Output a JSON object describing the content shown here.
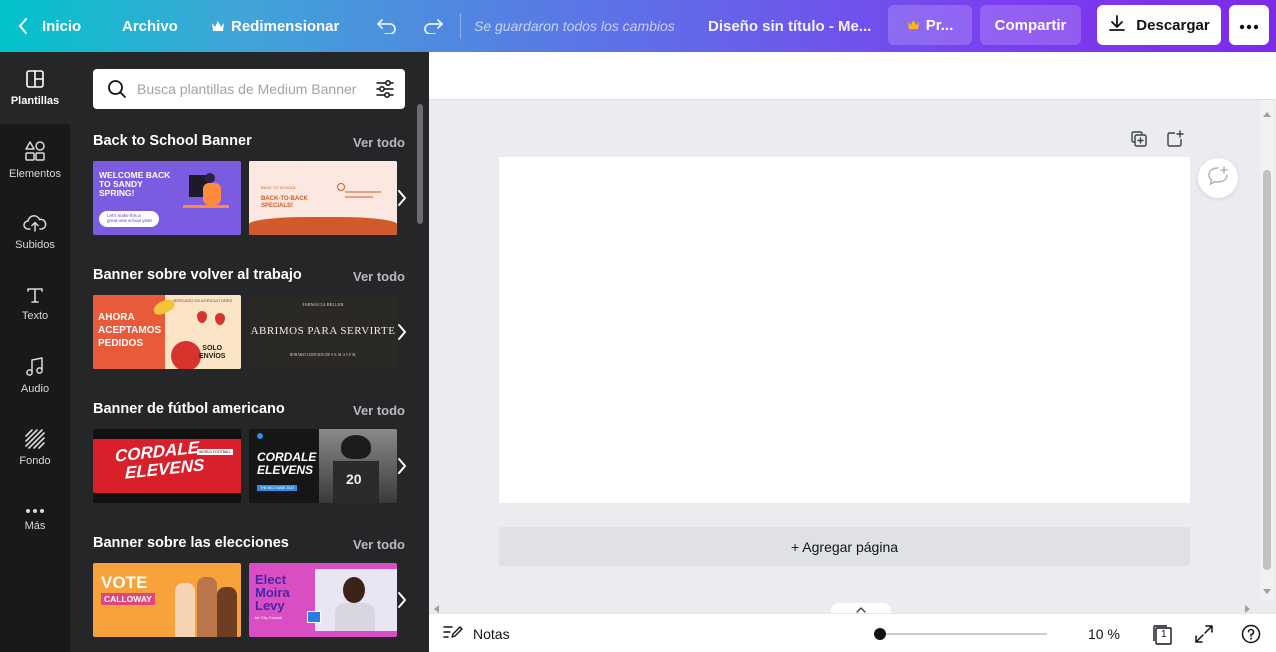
{
  "topbar": {
    "home": "Inicio",
    "file": "Archivo",
    "resize": "Redimensionar",
    "status": "Se guardaron todos los cambios",
    "doc_title": "Diseño sin título - Me...",
    "pro": "Pr...",
    "share": "Compartir",
    "download": "Descargar"
  },
  "rail": {
    "items": [
      {
        "label": "Plantillas",
        "icon": "templates-icon"
      },
      {
        "label": "Elementos",
        "icon": "elements-icon"
      },
      {
        "label": "Subidos",
        "icon": "upload-cloud-icon"
      },
      {
        "label": "Texto",
        "icon": "text-icon"
      },
      {
        "label": "Audio",
        "icon": "music-note-icon"
      },
      {
        "label": "Fondo",
        "icon": "background-hatch-icon"
      },
      {
        "label": "Más",
        "icon": "more-dots-icon"
      }
    ]
  },
  "panel": {
    "search_placeholder": "Busca plantillas de Medium Banner",
    "see_all": "Ver todo",
    "sections": [
      {
        "title": "Back to School Banner",
        "t1": {
          "line1": "WELCOME BACK",
          "line2": "TO SANDY",
          "line3": "SPRING!",
          "line4": "Let's make this a",
          "line5": "great new school year!"
        },
        "t2": {
          "line1": "BACK TO SCHOOL",
          "line2": "BACK-TO-BACK",
          "line3": "SPECIALS!"
        }
      },
      {
        "title": "Banner sobre volver al trabajo",
        "t1": {
          "line1": "AHORA",
          "line2": "ACEPTAMOS",
          "line3": "PEDIDOS",
          "line4": "SOLO",
          "line5": "ENVÍOS",
          "line6": "MERCADO DE AGRICULTORES"
        },
        "t2": {
          "line1": "FARMACIA BELLER",
          "line2": "ABRIMOS PARA SERVIRTE",
          "line3": "HORARIO LIMITADO DE 9 A. M. A 5 P. M."
        }
      },
      {
        "title": "Banner de fútbol americano",
        "t1": {
          "line1": "CORDALE",
          "line2": "ELEVENS",
          "line3": "WORLD FOOTBALL"
        },
        "t2": {
          "line1": "CORDALE",
          "line2": "ELEVENS",
          "line3": "THE BIG GAME 2022",
          "line4": "20"
        }
      },
      {
        "title": "Banner sobre las elecciones",
        "t1": {
          "line1": "VOTE",
          "line2": "CALLOWAY"
        },
        "t2": {
          "line1": "Elect",
          "line2": "Moira",
          "line3": "Levy",
          "line4": "for City Council"
        }
      }
    ]
  },
  "canvas": {
    "add_page": "+ Agregar página"
  },
  "bottom": {
    "notes": "Notas",
    "zoom": "10 %",
    "page_count": "1"
  },
  "colors": {
    "rail_bg": "#18191b",
    "panel_bg": "#252627",
    "accent_purple": "#7d2ae8",
    "accent_teal": "#01c3cc"
  }
}
